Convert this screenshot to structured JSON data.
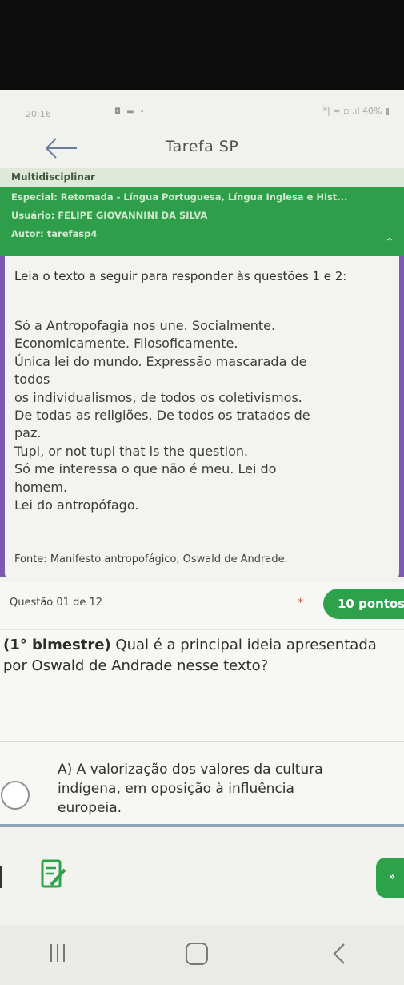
{
  "status_bar": {
    "time": "20:16",
    "notifications": "◘ ▬ •",
    "right_indicators": "ᴺ| ≈ ▫ .ıl 40% ▮"
  },
  "header": {
    "title": "Tarefa SP"
  },
  "info": {
    "category": "Multidisciplinar",
    "special": "Especial: Retomada - Língua Portuguesa, Língua Inglesa e Hist...",
    "user": "Usuário: FELIPE GIOVANNINI DA SILVA",
    "author": "Autor: tarefasp4"
  },
  "text_card": {
    "lead": "Leia o texto a seguir para responder às questões 1 e 2:",
    "poem_lines": [
      "Só a Antropofagia nos une. Socialmente.",
      "Economicamente. Filosoficamente.",
      "Única lei do mundo. Expressão mascarada de",
      "todos",
      "os individualismos, de todos os coletivismos.",
      "De todas as religiões. De todos os tratados de",
      "paz.",
      "Tupi, or not tupi that is the question.",
      "Só me interessa o que não é meu. Lei do",
      "homem.",
      "Lei do antropófago."
    ],
    "source": "Fonte: Manifesto antropofágico, Oswald de Andrade."
  },
  "question": {
    "number_label": "Questão 01 de 12",
    "required_mark": "*",
    "points": "10 pontos",
    "period": "(1° bimestre)",
    "text": "Qual é a principal ideia apresentada por Oswald de Andrade nesse texto?",
    "option_a": "A) A valorização dos valores da cultura\nindígena, em oposição à influência\neuropeia."
  },
  "bottom_bar": {
    "next_label": "»"
  }
}
